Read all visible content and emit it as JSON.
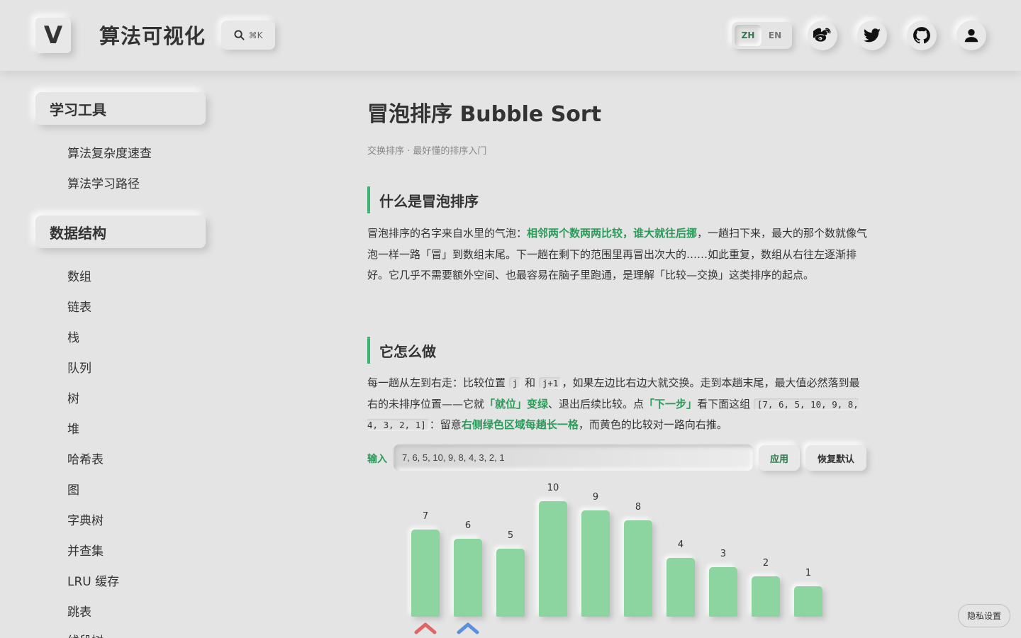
{
  "header": {
    "logo_letter": "V",
    "site_title": "算法可视化",
    "search_shortcut": "⌘K",
    "lang": {
      "zh": "ZH",
      "en": "EN",
      "active": "ZH"
    },
    "icons": [
      "weibo-icon",
      "twitter-icon",
      "github-icon",
      "user-icon"
    ]
  },
  "sidebar": {
    "sections": [
      {
        "title": "学习工具",
        "items": [
          "算法复杂度速查",
          "算法学习路径"
        ]
      },
      {
        "title": "数据结构",
        "items": [
          "数组",
          "链表",
          "栈",
          "队列",
          "树",
          "堆",
          "哈希表",
          "图",
          "字典树",
          "并查集",
          "LRU 缓存",
          "跳表",
          "线段树"
        ]
      }
    ]
  },
  "main": {
    "title": "冒泡排序 Bubble Sort",
    "subtitle": "交换排序 · 最好懂的排序入门",
    "section1": {
      "heading": "什么是冒泡排序",
      "p_a": "冒泡排序的名字来自水里的气泡：",
      "p_hl": "相邻两个数两两比较，谁大就往后挪",
      "p_b": "，一趟扫下来，最大的那个数就像气泡一样一路「冒」到数组末尾。下一趟在剩下的范围里再冒出次大的……如此重复，数组从右往左逐渐排好。它几乎不需要额外空间、也最容易在脑子里跑通，是理解「比较—交换」这类排序的起点。"
    },
    "section2": {
      "heading": "它怎么做",
      "t1": "每一趟从左到右走：比较位置 ",
      "code1": "j",
      "t2": " 和 ",
      "code2": "j+1",
      "t3": "，如果左边比右边大就交换。走到本趟末尾，最大值必然落到最右的未排序位置——它就",
      "hl1": "「就位」变绿",
      "t4": "、退出后续比较。点",
      "hl2": "「下一步」",
      "t5": "看下面这组 ",
      "code3": "[7, 6, 5, 10, 9, 8, 4, 3, 2, 1]",
      "t6": "：留意",
      "hl3": "右侧绿色区域每趟长一格",
      "t7": "，而黄色的比较对一路向右推。"
    },
    "input": {
      "label": "输入",
      "value": "7, 6, 5, 10, 9, 8, 4, 3, 2, 1",
      "apply": "应用",
      "reset": "恢复默认"
    },
    "array": [
      7,
      6,
      5,
      10,
      9,
      8,
      4,
      3,
      2,
      1
    ],
    "pointer_indices": [
      0,
      1
    ],
    "bar_color": "#8cd4a0",
    "pointer_colors": [
      "#e06666",
      "#5b8fe0"
    ]
  },
  "privacy_button": "隐私设置"
}
